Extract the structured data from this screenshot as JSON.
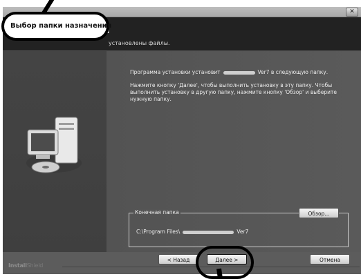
{
  "window": {
    "header_title": "Выбор папки назначения",
    "header_desc": "установлены файлы.",
    "close_label": "✕"
  },
  "main": {
    "install_prefix": "Программа установки установит",
    "install_suffix": "Ver7 в следующую папку.",
    "instructions": "Нажмите кнопку 'Далее', чтобы выполнить установку в эту папку. Чтобы выполнить установку в другую папку, нажмите кнопку 'Обзор' и выберите нужную папку."
  },
  "folder": {
    "legend": "Конечная папка",
    "path_prefix": "C:\\Program Files\\",
    "path_suffix": "Ver7",
    "browse_label": "Обзор..."
  },
  "footer": {
    "brand_bold": "Install",
    "brand_light": "Shield",
    "back_label": "< Назад",
    "next_label": "Далее >",
    "cancel_label": "Отмена"
  },
  "icons": {
    "computer": "computer-cd-icon"
  },
  "colors": {
    "header_bg": "#222222",
    "content_bg": "#555555",
    "callout_border": "#000000"
  }
}
